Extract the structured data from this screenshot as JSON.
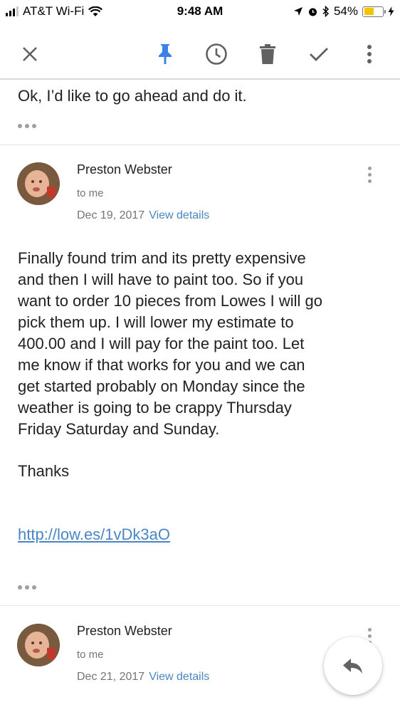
{
  "status_bar": {
    "carrier": "AT&T Wi-Fi",
    "time": "9:48 AM",
    "battery": "54%",
    "battery_level": 0.54
  },
  "toolbar": {
    "icons": [
      "close-icon",
      "pin-icon",
      "snooze-icon",
      "delete-icon",
      "done-icon",
      "more-vert-icon"
    ],
    "accent": "#3b82e8"
  },
  "previous_message": {
    "snippet": "Ok, I’d like to go ahead and do it."
  },
  "message": {
    "sender": "Preston Webster",
    "to": "to me",
    "date": "Dec 19, 2017",
    "view_details": "View details",
    "body_lines": [
      "Finally found trim and its pretty expensive",
      "and then I will have to paint too. So if you",
      "want to order 10 pieces from Lowes I will go",
      "pick them up. I will lower my estimate to",
      "400.00 and I will pay for the paint too. Let",
      "me know if that works for you and we can",
      "get started probably on Monday since the",
      "weather is going to be crappy Thursday",
      "Friday Saturday and Sunday."
    ],
    "thanks": "Thanks",
    "link": "http://low.es/1vDk3aO"
  },
  "next_message": {
    "sender": "Preston Webster",
    "to": "to me",
    "date": "Dec 21, 2017",
    "view_details": "View details"
  },
  "fab": {
    "icon": "reply-icon"
  },
  "colors": {
    "link": "#4a86c5",
    "pin": "#3b82e8",
    "battery": "#f5c400"
  }
}
